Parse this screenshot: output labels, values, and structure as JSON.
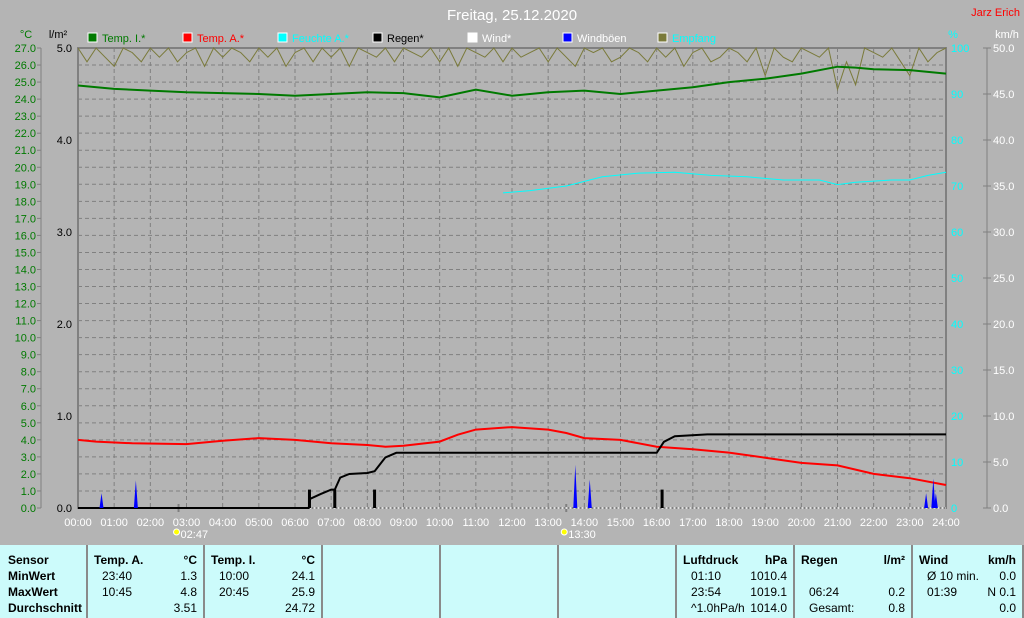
{
  "title": "Freitag, 25.12.2020",
  "author": "Jarz Erich",
  "axes": {
    "left_temp_unit": "°C",
    "left_rain_unit": "l/m²",
    "right_hum_unit": "%",
    "right_wind_unit": "km/h"
  },
  "legend": [
    {
      "label": "Temp. I.*",
      "color": "#007a00",
      "text_color": "#007a00"
    },
    {
      "label": "Temp. A.*",
      "color": "#ff0000",
      "text_color": "#ff0000"
    },
    {
      "label": "Feuchte A.*",
      "color": "#00ffff",
      "text_color": "#00ffff"
    },
    {
      "label": "Regen*",
      "color": "#000000",
      "text_color": "#000000"
    },
    {
      "label": "Wind*",
      "color": "#ffffff",
      "text_color": "#ffffff"
    },
    {
      "label": "Windböen",
      "color": "#0000ff",
      "text_color": "#ffffff"
    },
    {
      "label": "Empfang",
      "color": "#7a7a3a",
      "text_color": "#00ffff"
    }
  ],
  "chart_data": {
    "type": "line",
    "title": "Freitag, 25.12.2020",
    "x_range_hours": [
      0,
      24
    ],
    "x_ticks": [
      "00:00",
      "01:00",
      "02:00",
      "03:00",
      "04:00",
      "05:00",
      "06:00",
      "07:00",
      "08:00",
      "09:00",
      "10:00",
      "11:00",
      "12:00",
      "13:00",
      "14:00",
      "15:00",
      "16:00",
      "17:00",
      "18:00",
      "19:00",
      "20:00",
      "21:00",
      "22:00",
      "23:00",
      "24:00"
    ],
    "temp_axis": {
      "range": [
        0,
        27
      ],
      "ticks": [
        "0.0",
        "1.0",
        "2.0",
        "3.0",
        "4.0",
        "5.0",
        "6.0",
        "7.0",
        "8.0",
        "9.0",
        "10.0",
        "11.0",
        "12.0",
        "13.0",
        "14.0",
        "15.0",
        "16.0",
        "17.0",
        "18.0",
        "19.0",
        "20.0",
        "21.0",
        "22.0",
        "23.0",
        "24.0",
        "25.0",
        "26.0",
        "27.0"
      ]
    },
    "rain_axis": {
      "range": [
        0,
        5
      ],
      "ticks": [
        "0.0",
        "1.0",
        "2.0",
        "3.0",
        "4.0",
        "5.0"
      ]
    },
    "hum_axis": {
      "range": [
        0,
        100
      ],
      "ticks": [
        "0",
        "10",
        "20",
        "30",
        "40",
        "50",
        "60",
        "70",
        "80",
        "90",
        "100"
      ]
    },
    "wind_axis": {
      "range": [
        0,
        50
      ],
      "ticks": [
        "0.0",
        "5.0",
        "10.0",
        "15.0",
        "20.0",
        "25.0",
        "30.0",
        "35.0",
        "40.0",
        "45.0",
        "50.0"
      ]
    },
    "markers": [
      {
        "label": "02:47",
        "hour": 2.78,
        "icon": "moonrise-icon"
      },
      {
        "label": "13:30",
        "hour": 13.5,
        "icon": "moonset-icon"
      }
    ],
    "series": {
      "temp_inside": [
        [
          0,
          24.8
        ],
        [
          1,
          24.6
        ],
        [
          2,
          24.5
        ],
        [
          3,
          24.4
        ],
        [
          4,
          24.35
        ],
        [
          5,
          24.3
        ],
        [
          6,
          24.2
        ],
        [
          7,
          24.3
        ],
        [
          8,
          24.4
        ],
        [
          9,
          24.35
        ],
        [
          10,
          24.1
        ],
        [
          11,
          24.55
        ],
        [
          12,
          24.2
        ],
        [
          13,
          24.4
        ],
        [
          14,
          24.5
        ],
        [
          15,
          24.3
        ],
        [
          16,
          24.5
        ],
        [
          17,
          24.7
        ],
        [
          18,
          25.0
        ],
        [
          19,
          25.2
        ],
        [
          20,
          25.5
        ],
        [
          21,
          25.9
        ],
        [
          21.5,
          25.85
        ],
        [
          22,
          25.75
        ],
        [
          23,
          25.7
        ],
        [
          24,
          25.5
        ]
      ],
      "temp_outside": [
        [
          0,
          4.0
        ],
        [
          0.5,
          3.9
        ],
        [
          1.5,
          3.8
        ],
        [
          3,
          3.75
        ],
        [
          4,
          3.95
        ],
        [
          5,
          4.1
        ],
        [
          6,
          4.0
        ],
        [
          7,
          3.8
        ],
        [
          8,
          3.7
        ],
        [
          8.5,
          3.6
        ],
        [
          9,
          3.65
        ],
        [
          10,
          3.9
        ],
        [
          10.5,
          4.3
        ],
        [
          11,
          4.6
        ],
        [
          12,
          4.75
        ],
        [
          13,
          4.6
        ],
        [
          13.5,
          4.4
        ],
        [
          14,
          4.1
        ],
        [
          15,
          4.0
        ],
        [
          16,
          3.6
        ],
        [
          17,
          3.45
        ],
        [
          18,
          3.25
        ],
        [
          19,
          2.95
        ],
        [
          20,
          2.65
        ],
        [
          21,
          2.5
        ],
        [
          22,
          2.0
        ],
        [
          23,
          1.75
        ],
        [
          24,
          1.35
        ]
      ],
      "humidity": [
        [
          11.75,
          68.5
        ],
        [
          12.5,
          69
        ],
        [
          13.5,
          70
        ],
        [
          14.5,
          72
        ],
        [
          15.5,
          72.8
        ],
        [
          16.5,
          73
        ],
        [
          17.5,
          72.3
        ],
        [
          18.5,
          72
        ],
        [
          19.5,
          71.3
        ],
        [
          20.5,
          71.3
        ],
        [
          21,
          70.3
        ],
        [
          21.5,
          70.8
        ],
        [
          22.5,
          71.3
        ],
        [
          23,
          71.3
        ],
        [
          23.5,
          72.3
        ],
        [
          24,
          73
        ]
      ],
      "rain_total": [
        [
          0,
          0
        ],
        [
          6.38,
          0
        ],
        [
          6.42,
          0.1
        ],
        [
          6.7,
          0.15
        ],
        [
          7.0,
          0.2
        ],
        [
          7.1,
          0.2
        ],
        [
          7.25,
          0.33
        ],
        [
          7.5,
          0.37
        ],
        [
          8.0,
          0.38
        ],
        [
          8.2,
          0.4
        ],
        [
          8.5,
          0.55
        ],
        [
          8.8,
          0.6
        ],
        [
          16.0,
          0.6
        ],
        [
          16.2,
          0.72
        ],
        [
          16.5,
          0.78
        ],
        [
          17.4,
          0.8
        ],
        [
          24,
          0.8
        ]
      ],
      "rain_events": [
        [
          6.4,
          0.2
        ],
        [
          7.1,
          0.2
        ],
        [
          8.2,
          0.2
        ],
        [
          16.15,
          0.2
        ]
      ],
      "wind": [
        [
          6.4,
          0
        ],
        [
          24,
          0
        ]
      ],
      "wind_gusts": [
        [
          0.65,
          1.6
        ],
        [
          1.6,
          3.0
        ],
        [
          13.75,
          4.7
        ],
        [
          14.15,
          3.1
        ],
        [
          23.45,
          1.6
        ],
        [
          23.65,
          3.2
        ],
        [
          23.72,
          1.6
        ]
      ],
      "reception": [
        100,
        97,
        100,
        98,
        96,
        100,
        99,
        97,
        100,
        98,
        100,
        97,
        99,
        100,
        96,
        100,
        98,
        100,
        99,
        97,
        100,
        98,
        100,
        96,
        99,
        100,
        97,
        100,
        98,
        100,
        96,
        100,
        99,
        98,
        100,
        97,
        100,
        99,
        98,
        100,
        97,
        100,
        96,
        100,
        99,
        98,
        100,
        97,
        100,
        98,
        99,
        100,
        97,
        100,
        98,
        96,
        100,
        99,
        100,
        97,
        98,
        100,
        99,
        97,
        100,
        98,
        100,
        96,
        99,
        100,
        97,
        98,
        100,
        99,
        97,
        100,
        94,
        100,
        98,
        97,
        100,
        99,
        98,
        100,
        91,
        97,
        92,
        100,
        99,
        98,
        100,
        97,
        94,
        100,
        97,
        99,
        100
      ]
    }
  },
  "table": {
    "columns": [
      {
        "header": "Sensor",
        "unit": "",
        "rows": [
          "MinWert",
          "MaxWert",
          "Durchschnitt"
        ]
      },
      {
        "header": "Temp. A.",
        "unit": "°C",
        "rows": [
          [
            "23:40",
            "1.3"
          ],
          [
            "10:45",
            "4.8"
          ],
          [
            "",
            "3.51"
          ]
        ]
      },
      {
        "header": "Temp. I.",
        "unit": "°C",
        "rows": [
          [
            "10:00",
            "24.1"
          ],
          [
            "20:45",
            "25.9"
          ],
          [
            "",
            "24.72"
          ]
        ]
      },
      {
        "header": "Luftdruck",
        "unit": "hPa",
        "rows": [
          [
            "01:10",
            "1010.4"
          ],
          [
            "23:54",
            "1019.1"
          ],
          [
            "^1.0hPa/h",
            "1014.0"
          ]
        ]
      },
      {
        "header": "Regen",
        "unit": "l/m²",
        "rows": [
          [
            "",
            ""
          ],
          [
            "06:24",
            "0.2"
          ],
          [
            "Gesamt:",
            "0.8"
          ]
        ]
      },
      {
        "header": "Wind",
        "unit": "km/h",
        "rows": [
          [
            "Ø 10 min.",
            "0.0"
          ],
          [
            "01:39",
            "N 0.1"
          ],
          [
            "",
            "0.0"
          ]
        ]
      }
    ]
  }
}
